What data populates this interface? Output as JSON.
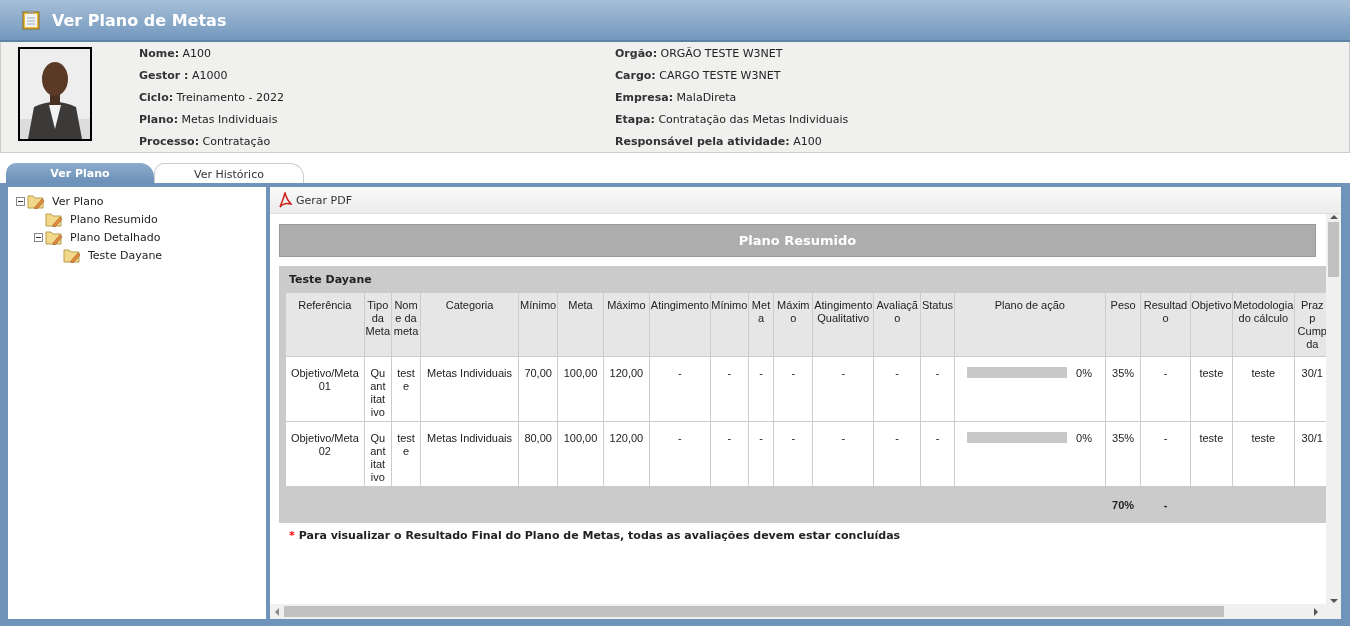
{
  "header": {
    "title": "Ver Plano de Metas"
  },
  "profile": {
    "left": [
      {
        "label": "Nome:",
        "value": "A100"
      },
      {
        "label": "Gestor :",
        "value": "A1000"
      },
      {
        "label": "Ciclo:",
        "value": "Treinamento - 2022"
      },
      {
        "label": "Plano:",
        "value": "Metas Individuais"
      },
      {
        "label": "Processo:",
        "value": "Contratação"
      }
    ],
    "right": [
      {
        "label": "Orgão:",
        "value": "ORGÃO TESTE W3NET"
      },
      {
        "label": "Cargo:",
        "value": "CARGO TESTE W3NET"
      },
      {
        "label": "Empresa:",
        "value": "MalaDireta"
      },
      {
        "label": "Etapa:",
        "value": "Contratação das Metas Individuais"
      },
      {
        "label": "Responsável pela atividade:",
        "value": "A100"
      }
    ]
  },
  "tabs": [
    {
      "label": "Ver Plano",
      "selected": true
    },
    {
      "label": "Ver Histórico",
      "selected": false
    }
  ],
  "tree": [
    {
      "label": "Ver Plano",
      "expanded": true,
      "children": [
        {
          "label": "Plano Resumido"
        },
        {
          "label": "Plano Detalhado",
          "expanded": true,
          "children": [
            {
              "label": "Teste Dayane"
            }
          ]
        }
      ]
    }
  ],
  "toolbar": {
    "pdf_button": "Gerar PDF"
  },
  "section_title": "Plano Resumido",
  "group_title": "Teste Dayane",
  "table": {
    "columns": [
      "Referência",
      "Tipo da Meta",
      "Nome da meta",
      "Categoria",
      "Mínimo",
      "Meta",
      "Máximo",
      "Atingimento",
      "Mínimo",
      "Meta",
      "Máximo",
      "Atingimento Qualitativo",
      "Avaliação",
      "Status",
      "Plano de ação",
      "Peso",
      "Resultado",
      "Objetivo",
      "Metodologia do cálculo",
      "Praz\np\nCump\nda"
    ],
    "rows": [
      {
        "cells": [
          {
            "kind": "text",
            "text": "Objetivo/Meta 01"
          },
          {
            "kind": "text",
            "text": "Quantitativo"
          },
          {
            "kind": "text",
            "text": "teste"
          },
          {
            "kind": "text",
            "text": "Metas Individuais"
          },
          {
            "kind": "text",
            "text": "70,00"
          },
          {
            "kind": "text",
            "text": "100,00"
          },
          {
            "kind": "text",
            "text": "120,00"
          },
          {
            "kind": "text",
            "text": "-"
          },
          {
            "kind": "text",
            "text": "-"
          },
          {
            "kind": "text",
            "text": "-"
          },
          {
            "kind": "text",
            "text": "-"
          },
          {
            "kind": "text",
            "text": "-"
          },
          {
            "kind": "text",
            "text": "-"
          },
          {
            "kind": "text",
            "text": "-"
          },
          {
            "kind": "progress",
            "level": 0,
            "reading": "0%"
          },
          {
            "kind": "text",
            "text": "35%"
          },
          {
            "kind": "text",
            "text": "-"
          },
          {
            "kind": "text",
            "text": "teste"
          },
          {
            "kind": "text",
            "text": "teste"
          },
          {
            "kind": "text",
            "text": "30/1"
          }
        ]
      },
      {
        "cells": [
          {
            "kind": "text",
            "text": "Objetivo/Meta 02"
          },
          {
            "kind": "text",
            "text": "Quantitativo"
          },
          {
            "kind": "text",
            "text": "teste"
          },
          {
            "kind": "text",
            "text": "Metas Individuais"
          },
          {
            "kind": "text",
            "text": "80,00"
          },
          {
            "kind": "text",
            "text": "100,00"
          },
          {
            "kind": "text",
            "text": "120,00"
          },
          {
            "kind": "text",
            "text": "-"
          },
          {
            "kind": "text",
            "text": "-"
          },
          {
            "kind": "text",
            "text": "-"
          },
          {
            "kind": "text",
            "text": "-"
          },
          {
            "kind": "text",
            "text": "-"
          },
          {
            "kind": "text",
            "text": "-"
          },
          {
            "kind": "text",
            "text": "-"
          },
          {
            "kind": "progress",
            "level": 0,
            "reading": "0%"
          },
          {
            "kind": "text",
            "text": "35%"
          },
          {
            "kind": "text",
            "text": "-"
          },
          {
            "kind": "text",
            "text": "teste"
          },
          {
            "kind": "text",
            "text": "teste"
          },
          {
            "kind": "text",
            "text": "30/1"
          }
        ]
      }
    ],
    "totals": {
      "weight": "70%",
      "result": "-"
    }
  },
  "footnote": {
    "mark": "*",
    "text": "Para visualizar o Resultado Final do Plano de Metas, todas as avaliações devem estar concluídas"
  }
}
